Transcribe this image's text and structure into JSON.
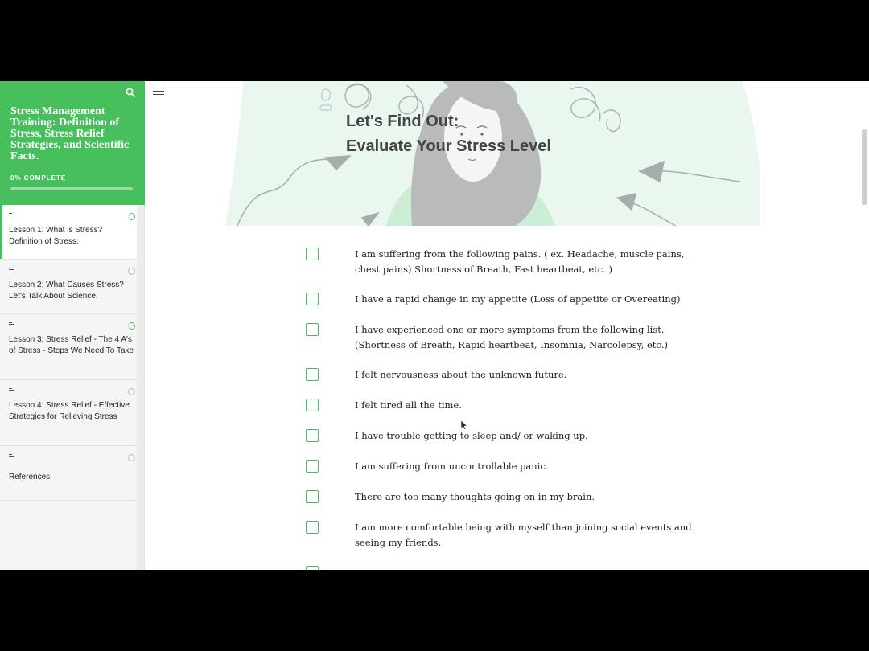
{
  "sidebar": {
    "course_title": "Stress Management Training: Definition of Stress, Stress Relief Strategies, and Scientific Facts.",
    "progress_label": "0% COMPLETE",
    "progress": 0,
    "search_icon": "search-icon",
    "lessons": [
      {
        "title": "Lesson 1: What is Stress? Definition of Stress.",
        "status": "started",
        "active": true
      },
      {
        "title": "Lesson 2: What Causes Stress? Let's Talk About Science.",
        "status": "not-started",
        "active": false
      },
      {
        "title": "Lesson 3: Stress Relief - The 4 A's of Stress - Steps We Need To Take",
        "status": "started",
        "active": false
      },
      {
        "title": "Lesson 4: Stress Relief - Effective Strategies for Relieving Stress",
        "status": "not-started",
        "active": false
      },
      {
        "title": "References",
        "status": "not-started",
        "active": false
      }
    ]
  },
  "main": {
    "menu_icon": "menu-icon",
    "hero": {
      "title_line1": "Let's Find Out:",
      "title_line2": "Evaluate Your Stress Level"
    },
    "checklist": [
      "I  am suffering from the following pains. ( ex. Headache, muscle pains,  chest pains)  Shortness of Breath, Fast heartbeat, etc. )",
      "I have a rapid change in my appetite (Loss of appetite or Overeating)",
      "I have experienced one or more symptoms from the following list. (Shortness of Breath, Rapid heartbeat, Insomnia, Narcolepsy, etc.)",
      "I felt nervousness about the unknown future.",
      "I felt tired all the time.",
      "I have trouble getting to sleep and/ or waking up.",
      "I am suffering from uncontrollable panic.",
      "There are too many thoughts going on in my brain.",
      "I am more comfortable being with myself than joining social events and seeing my friends."
    ]
  },
  "colors": {
    "accent": "#47bf5c",
    "hero_bg": "#eaf7ee"
  }
}
